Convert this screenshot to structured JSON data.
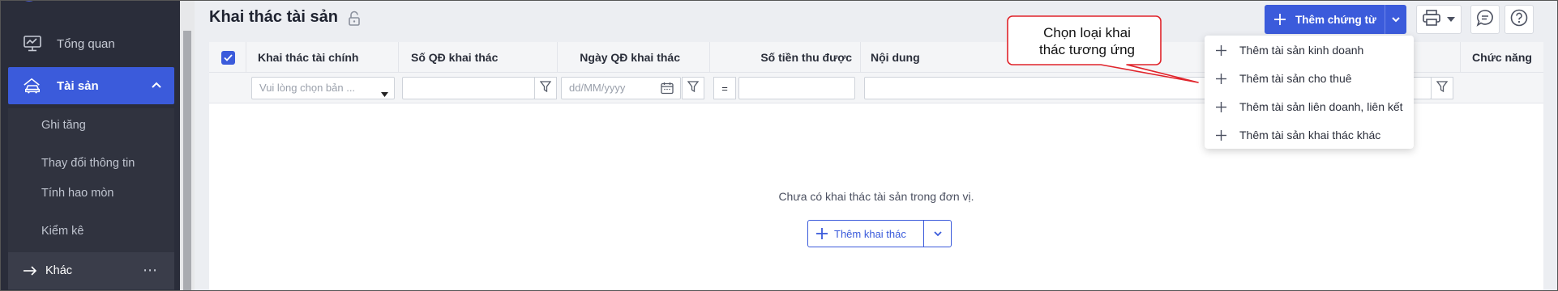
{
  "sidebar": {
    "items": [
      {
        "label": "Tổng quan",
        "icon": "monitor-chart-icon"
      },
      {
        "label": "Tài sản",
        "icon": "car-house-icon",
        "active": true
      }
    ],
    "sub_items": [
      {
        "label": "Ghi tăng"
      },
      {
        "label": "Thay đổi thông tin"
      },
      {
        "label": "Tính hao mòn"
      },
      {
        "label": "Kiểm kê"
      }
    ],
    "other": {
      "label": "Khác",
      "icon": "arrow-right-icon"
    }
  },
  "header": {
    "title": "Khai thác tài sản",
    "add_button": "Thêm chứng từ"
  },
  "table": {
    "columns": [
      {
        "label": "Khai thác tài chính"
      },
      {
        "label": "Số QĐ khai thác"
      },
      {
        "label": "Ngày QĐ khai thác"
      },
      {
        "label": "Số tiền thu được"
      },
      {
        "label": "Nội dung"
      },
      {
        "label": "Chức năng"
      }
    ],
    "filters": {
      "type_placeholder": "Vui lòng chọn bản ...",
      "date_placeholder": "dd/MM/yyyy",
      "operator": "="
    },
    "empty_message": "Chưa có khai thác tài sản trong đơn vị.",
    "empty_button": "Thêm khai thác"
  },
  "menu": {
    "items": [
      {
        "label": "Thêm tài sản kinh doanh"
      },
      {
        "label": "Thêm tài sản cho thuê"
      },
      {
        "label": "Thêm tài sản liên doanh, liên kết"
      },
      {
        "label": "Thêm tài sản khai thác khác"
      }
    ]
  },
  "callout": {
    "line1": "Chọn loại khai",
    "line2": "thác tương ứng"
  },
  "colors": {
    "accent": "#3b5bdb",
    "sidebar_bg": "#2a2d3a",
    "callout_border": "#e0242b"
  }
}
